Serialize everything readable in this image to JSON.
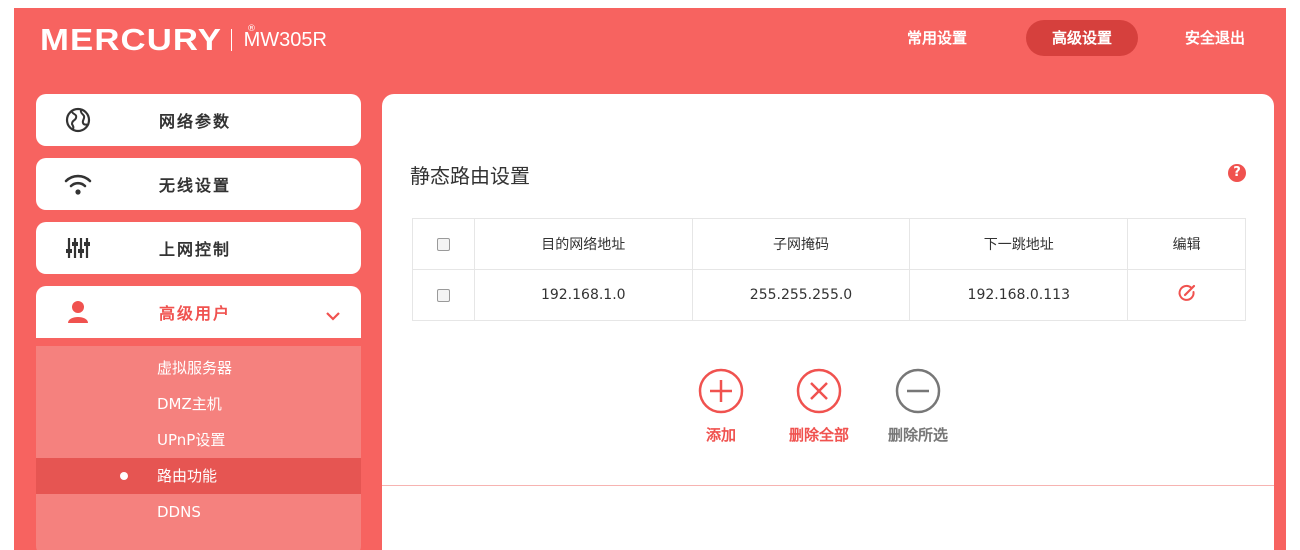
{
  "header": {
    "brand": "MERCURY",
    "brand_mark": "®",
    "model": "MW305R",
    "nav": {
      "common": "常用设置",
      "advanced": "高级设置",
      "logout": "安全退出"
    }
  },
  "sidebar": {
    "items": [
      {
        "label": "网络参数",
        "icon": "globe-icon"
      },
      {
        "label": "无线设置",
        "icon": "wifi-icon"
      },
      {
        "label": "上网控制",
        "icon": "sliders-icon"
      },
      {
        "label": "高级用户",
        "icon": "user-icon"
      }
    ],
    "submenu": [
      {
        "label": "虚拟服务器"
      },
      {
        "label": "DMZ主机"
      },
      {
        "label": "UPnP设置"
      },
      {
        "label": "路由功能"
      },
      {
        "label": "DDNS"
      }
    ]
  },
  "main": {
    "title": "静态路由设置",
    "help": "?",
    "table": {
      "headers": [
        "目的网络地址",
        "子网掩码",
        "下一跳地址",
        "编辑"
      ],
      "rows": [
        {
          "dest": "192.168.1.0",
          "mask": "255.255.255.0",
          "gateway": "192.168.0.113"
        }
      ]
    },
    "actions": {
      "add": "添加",
      "delete_all": "删除全部",
      "delete_selected": "删除所选"
    }
  },
  "colors": {
    "brand": "#f76360",
    "accent": "#f0524f",
    "active_nav": "#d6403d"
  }
}
